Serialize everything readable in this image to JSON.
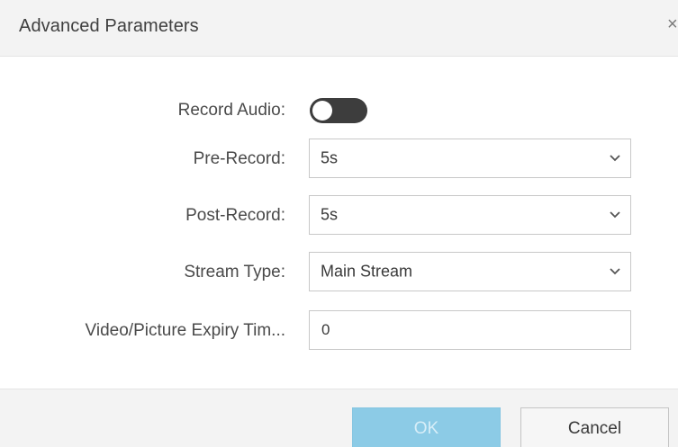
{
  "dialog": {
    "title": "Advanced Parameters",
    "close_glyph": "×"
  },
  "form": {
    "record_audio": {
      "label": "Record Audio:",
      "enabled": false
    },
    "pre_record": {
      "label": "Pre-Record:",
      "value": "5s"
    },
    "post_record": {
      "label": "Post-Record:",
      "value": "5s"
    },
    "stream_type": {
      "label": "Stream Type:",
      "value": "Main Stream"
    },
    "expiry_time": {
      "label": "Video/Picture Expiry Tim...",
      "value": "0"
    }
  },
  "footer": {
    "ok_label": "OK",
    "cancel_label": "Cancel"
  },
  "colors": {
    "ok_button": "#8ccbe6",
    "toggle_off": "#3d3d3d",
    "header_bg": "#f3f3f3"
  }
}
